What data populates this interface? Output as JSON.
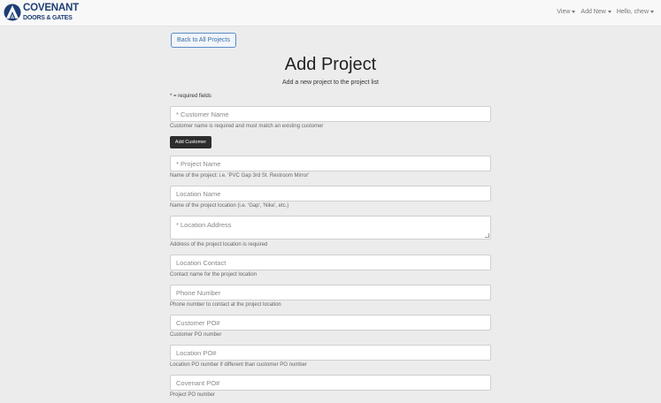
{
  "brand": {
    "line1": "COVENANT",
    "line2": "DOORS & GATES"
  },
  "nav": {
    "view": "View",
    "add_new": "Add New",
    "user": "Hello, chew"
  },
  "page": {
    "back_label": "Back to All Projects",
    "title": "Add Project",
    "subtitle": "Add a new project to the project list",
    "required_note": "* = required fields"
  },
  "form": {
    "customer_name": {
      "placeholder": "* Customer Name",
      "help": "Customer name is required and must match an existing customer"
    },
    "add_customer_label": "Add Customer",
    "project_name": {
      "placeholder": "* Project Name",
      "help": "Name of the project: i.e. 'PVC Gap 3rd St. Restroom Mirror'"
    },
    "location_name": {
      "placeholder": "Location Name",
      "help": "Name of the project location (i.e. 'Gap', 'Nike', etc.)"
    },
    "location_address": {
      "placeholder": "* Location Address",
      "help": "Address of the project location is required"
    },
    "location_contact": {
      "placeholder": "Location Contact",
      "help": "Contact name for the project location"
    },
    "phone_number": {
      "placeholder": "Phone Number",
      "help": "Phone number to contact at the project location"
    },
    "customer_po": {
      "placeholder": "Customer PO#",
      "help": "Customer PO number"
    },
    "location_po": {
      "placeholder": "Location PO#",
      "help": "Location PO number if different than customer PO number"
    },
    "covenant_po": {
      "placeholder": "Covenant PO#",
      "help": "Project PO number"
    }
  }
}
